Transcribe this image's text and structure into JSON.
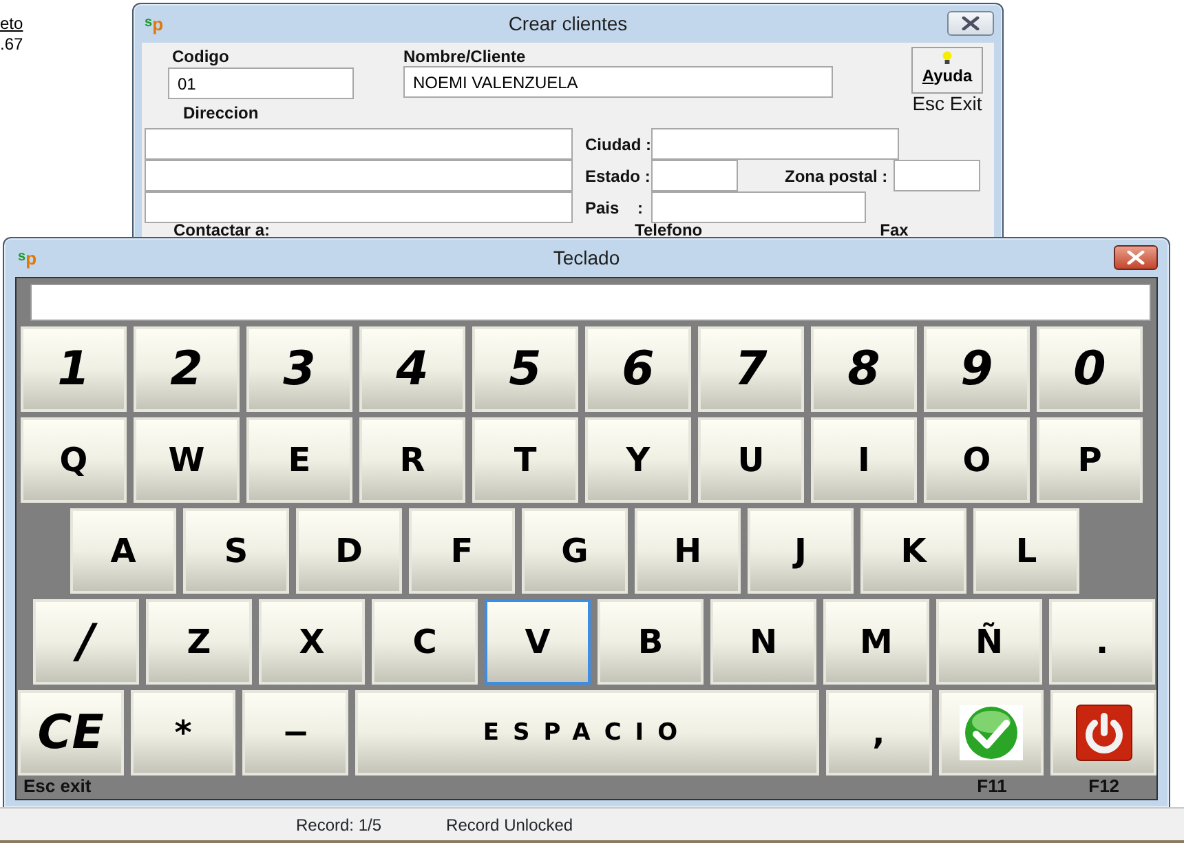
{
  "background_texts": [
    {
      "text": "eto",
      "kind": "link"
    },
    {
      "text": ".67",
      "kind": "plain"
    }
  ],
  "customer_window": {
    "logo": "$^{s}$p",
    "title": "Crear clientes",
    "codigo": {
      "label": "Codigo",
      "value": "01"
    },
    "nombre": {
      "label": "Nombre/Cliente",
      "value": "NOEMI VALENZUELA"
    },
    "help_button": {
      "label": "Ayuda",
      "underline_first": true
    },
    "exit_hint": "Esc Exit",
    "direccion_label": "Direccion",
    "ciudad_label": "Ciudad :",
    "estado_label": "Estado :",
    "zona_label": "Zona postal :",
    "pais_label": "Pais    :",
    "contact_labels": [
      "Contactar a:",
      "Telefono",
      "Fax"
    ]
  },
  "keyboard_window": {
    "logo": "$^{s}$p",
    "title": "Teclado",
    "rows": [
      {
        "keys": [
          {
            "label": "1",
            "kind": "digit",
            "focused": false
          },
          {
            "label": "2",
            "kind": "digit",
            "focused": false
          },
          {
            "label": "3",
            "kind": "digit",
            "focused": false
          },
          {
            "label": "4",
            "kind": "digit",
            "focused": false
          },
          {
            "label": "5",
            "kind": "digit",
            "focused": false
          },
          {
            "label": "6",
            "kind": "digit",
            "focused": false
          },
          {
            "label": "7",
            "kind": "digit",
            "focused": false
          },
          {
            "label": "8",
            "kind": "digit",
            "focused": false
          },
          {
            "label": "9",
            "kind": "digit",
            "focused": false
          },
          {
            "label": "0",
            "kind": "digit",
            "focused": false
          }
        ]
      },
      {
        "keys": [
          {
            "label": "Q",
            "kind": "letter",
            "focused": false
          },
          {
            "label": "W",
            "kind": "letter",
            "focused": false
          },
          {
            "label": "E",
            "kind": "letter",
            "focused": false
          },
          {
            "label": "R",
            "kind": "letter",
            "focused": false
          },
          {
            "label": "T",
            "kind": "letter",
            "focused": false
          },
          {
            "label": "Y",
            "kind": "letter",
            "focused": false
          },
          {
            "label": "U",
            "kind": "letter",
            "focused": false
          },
          {
            "label": "I",
            "kind": "letter",
            "focused": false
          },
          {
            "label": "O",
            "kind": "letter",
            "focused": false
          },
          {
            "label": "P",
            "kind": "letter",
            "focused": false
          }
        ]
      },
      {
        "keys": [
          {
            "label": "A",
            "kind": "letter",
            "focused": false
          },
          {
            "label": "S",
            "kind": "letter",
            "focused": false
          },
          {
            "label": "D",
            "kind": "letter",
            "focused": false
          },
          {
            "label": "F",
            "kind": "letter",
            "focused": false
          },
          {
            "label": "G",
            "kind": "letter",
            "focused": false
          },
          {
            "label": "H",
            "kind": "letter",
            "focused": false
          },
          {
            "label": "J",
            "kind": "letter",
            "focused": false
          },
          {
            "label": "K",
            "kind": "letter",
            "focused": false
          },
          {
            "label": "L",
            "kind": "letter",
            "focused": false
          }
        ]
      },
      {
        "keys": [
          {
            "label": "/",
            "kind": "digit",
            "focused": false
          },
          {
            "label": "Z",
            "kind": "letter",
            "focused": false
          },
          {
            "label": "X",
            "kind": "letter",
            "focused": false
          },
          {
            "label": "C",
            "kind": "letter",
            "focused": false
          },
          {
            "label": "V",
            "kind": "letter",
            "focused": true
          },
          {
            "label": "B",
            "kind": "letter",
            "focused": false
          },
          {
            "label": "N",
            "kind": "letter",
            "focused": false
          },
          {
            "label": "M",
            "kind": "letter",
            "focused": false
          },
          {
            "label": "Ñ",
            "kind": "letter",
            "focused": false
          },
          {
            "label": ".",
            "kind": "letter",
            "focused": false
          }
        ]
      },
      {
        "keys": [
          {
            "label": "CE",
            "kind": "digit",
            "focused": false,
            "caption": "Esc exit"
          },
          {
            "label": "*",
            "kind": "letter",
            "focused": false
          },
          {
            "label": "−",
            "kind": "letter",
            "focused": false
          },
          {
            "label": "ESPACIO",
            "kind": "space",
            "focused": false
          },
          {
            "label": ",",
            "kind": "letter",
            "focused": false
          },
          {
            "kind": "ok",
            "focused": false,
            "caption": "F11"
          },
          {
            "kind": "power",
            "focused": false,
            "caption": "F12"
          }
        ]
      }
    ]
  },
  "status_bar": [
    "Record: 1/5",
    "Record Unlocked"
  ]
}
